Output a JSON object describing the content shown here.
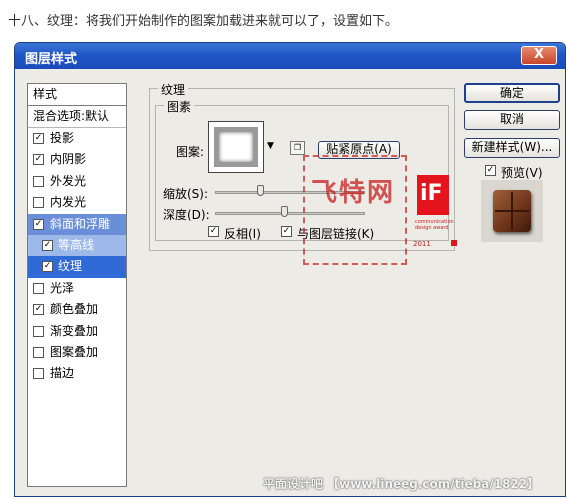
{
  "caption": "十八、纹理：将我们开始制作的图案加载进来就可以了，设置如下。",
  "dialog": {
    "title": "图层样式",
    "close_label": "X"
  },
  "styles_panel": {
    "header": "样式",
    "blend_options": "混合选项:默认",
    "items": [
      {
        "label": "投影",
        "checked": true
      },
      {
        "label": "内阴影",
        "checked": true
      },
      {
        "label": "外发光",
        "checked": false
      },
      {
        "label": "内发光",
        "checked": false
      },
      {
        "label": "斜面和浮雕",
        "checked": true
      },
      {
        "label": "等高线",
        "checked": true
      },
      {
        "label": "纹理",
        "checked": true
      },
      {
        "label": "光泽",
        "checked": false
      },
      {
        "label": "颜色叠加",
        "checked": true
      },
      {
        "label": "渐变叠加",
        "checked": false
      },
      {
        "label": "图案叠加",
        "checked": false
      },
      {
        "label": "描边",
        "checked": false
      }
    ]
  },
  "texture": {
    "group_title": "纹理",
    "pattern_group_title": "图素",
    "pattern_label": "图案:",
    "snap_button": "贴紧原点(A)",
    "scale_label": "缩放(S):",
    "depth_label": "深度(D):",
    "invert_label": "反相(I)",
    "invert_checked": true,
    "link_label": "与图层链接(K)",
    "link_checked": true
  },
  "buttons": {
    "ok": "确定",
    "cancel": "取消",
    "new_style": "新建样式(W)...",
    "preview": "预览(V)",
    "preview_checked": true
  },
  "watermark": {
    "seal_text": "飞特网",
    "if_logo": "iF",
    "if_caption": "communication design award",
    "if_year": "2011",
    "footer": "平面设计吧  【www.lineeg.com/tieba/1822】"
  },
  "icons": {
    "checkmark": "✓",
    "dropdown": "▼",
    "new_preset": "❐"
  }
}
